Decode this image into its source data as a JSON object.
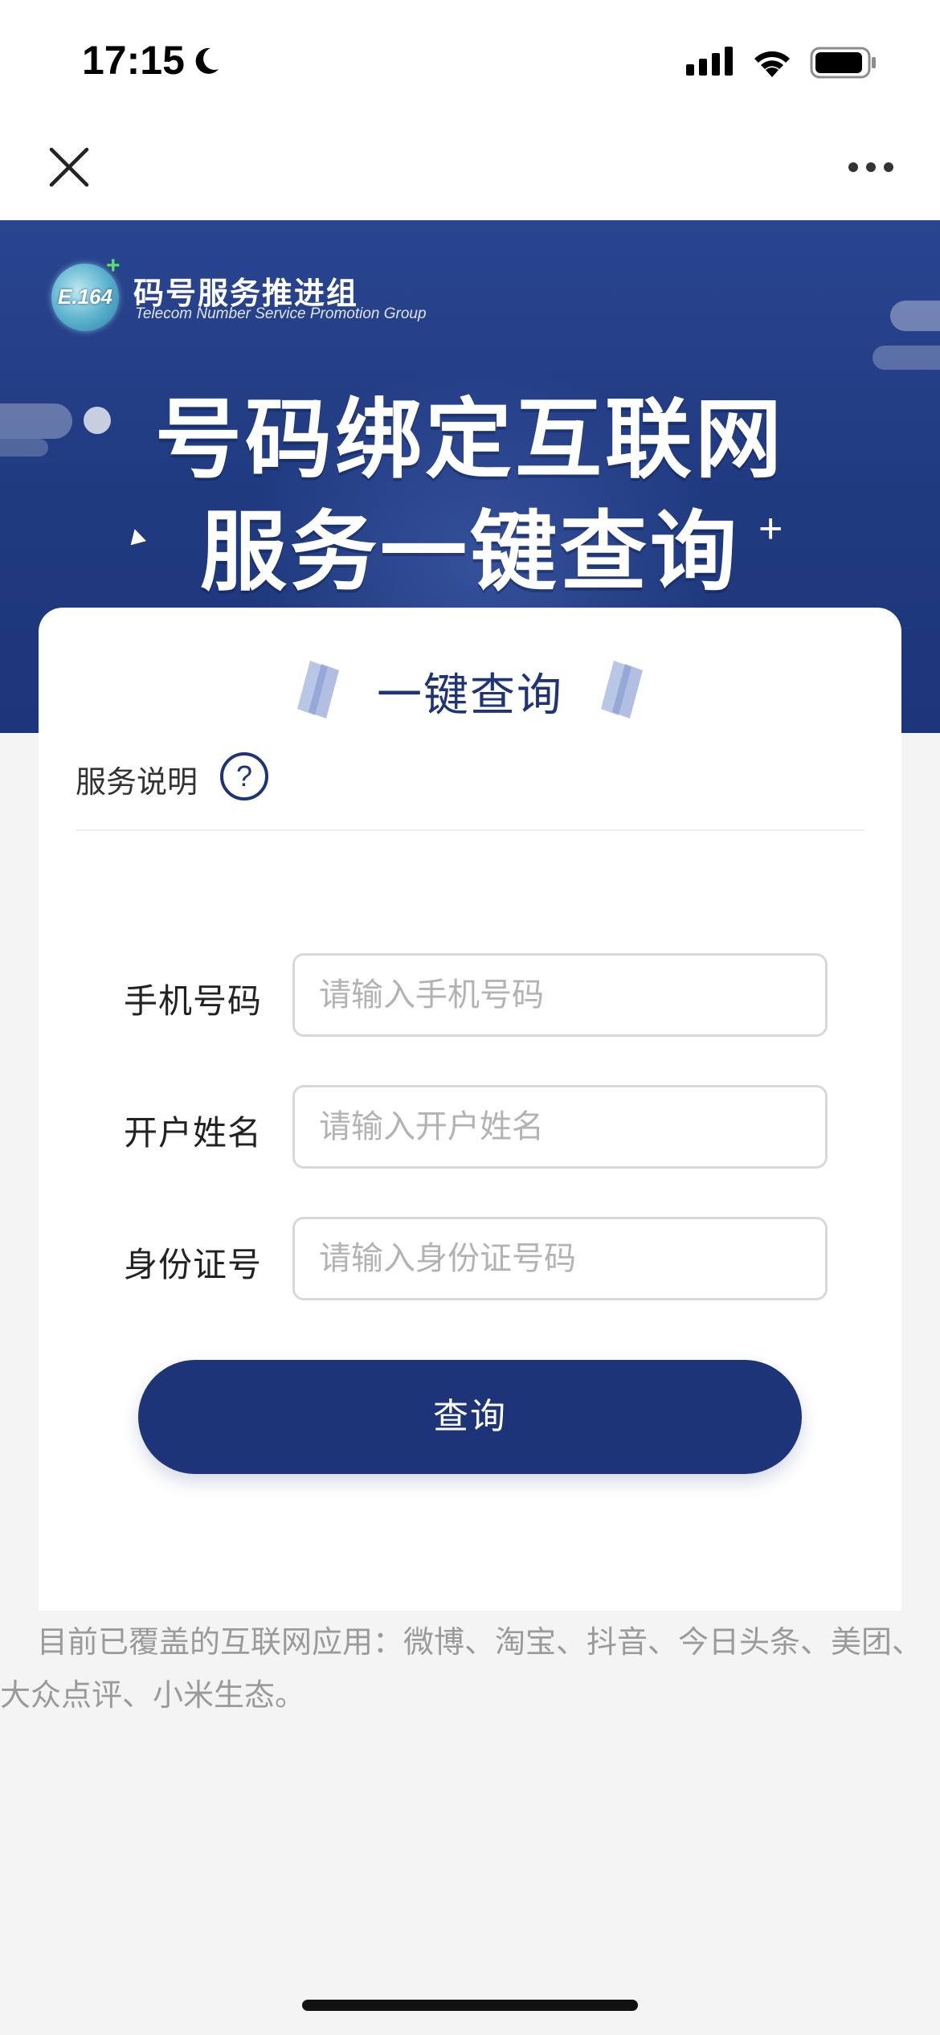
{
  "status_bar": {
    "time": "17:15",
    "moon_icon": "moon-icon",
    "signal_icon": "cellular-signal-icon",
    "wifi_icon": "wifi-icon",
    "battery_icon": "battery-icon"
  },
  "nav": {
    "close_icon": "close-icon",
    "more_icon": "more-dots-icon"
  },
  "banner": {
    "logo_text": "E.164",
    "org_name": "码号服务推进组",
    "org_name_en": "Telecom Number Service  Promotion Group",
    "headline_line1": "号码绑定互联网",
    "headline_line2": "服务一键查询"
  },
  "card": {
    "title": "一键查询",
    "service_label": "服务说明",
    "help_icon": "?",
    "fields": [
      {
        "label": "手机号码",
        "placeholder": "请输入手机号码",
        "value": ""
      },
      {
        "label": "开户姓名",
        "placeholder": "请输入开户姓名",
        "value": ""
      },
      {
        "label": "身份证号",
        "placeholder": "请输入身份证号码",
        "value": ""
      }
    ],
    "submit_label": "查询"
  },
  "coverage_text": "目前已覆盖的互联网应用：微博、淘宝、抖音、今日头条、美团、大众点评、小米生态。",
  "colors": {
    "brand_blue": "#1d3478",
    "banner_blue": "#203a80",
    "background": "#f4f4f4"
  }
}
